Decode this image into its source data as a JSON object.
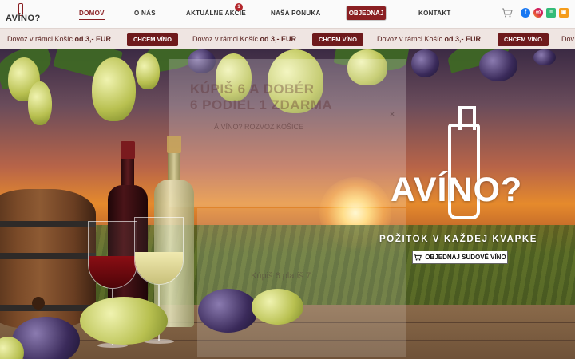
{
  "header": {
    "logo_text": "AVÍNO?",
    "nav": [
      {
        "label": "DOMOV"
      },
      {
        "label": "O NÁS"
      },
      {
        "label": "AKTUÁLNE AKCIE"
      },
      {
        "label": "NAŠA PONUKA"
      },
      {
        "label": "OBJEDNAJ"
      },
      {
        "label": "KONTAKT"
      }
    ],
    "badge_count": "1",
    "icons": [
      "cart-icon",
      "facebook-icon",
      "instagram-icon",
      "bolt-food-icon",
      "wolt-icon"
    ]
  },
  "ticker": {
    "items": [
      {
        "text_prefix": "Dovoz v rámci Košíc ",
        "text_bold": "od 3,- EUR",
        "button": "CHCEM VÍNO"
      },
      {
        "text_prefix": "Dovoz v rámci Košíc ",
        "text_bold": "od 3,- EUR",
        "button": "CHCEM VÍNO"
      },
      {
        "text_prefix": "Dovoz v rámci Košíc ",
        "text_bold": "od 3,- EUR",
        "button": "CHCEM VÍNO"
      }
    ],
    "trailing": "Dov"
  },
  "hero": {
    "brand": "AVÍNO?",
    "tagline": "POŽITOK V KAŽDEJ KVAPKE",
    "cta": "OBJEDNAJ SUDOVÉ VÍNO"
  },
  "ghost_popup": {
    "title": "KÚPIŠ 6 A DOBÉR",
    "title2": "6 PODIEL 1 ZDARMA",
    "sub": "Á VÍNO?   ROZVOZ KOŠICE",
    "close": "×",
    "inner_title": "Kúpiš 6 platíš 7"
  },
  "colors": {
    "accent": "#8a1f22",
    "ticker_bg": "#efe5e2"
  }
}
